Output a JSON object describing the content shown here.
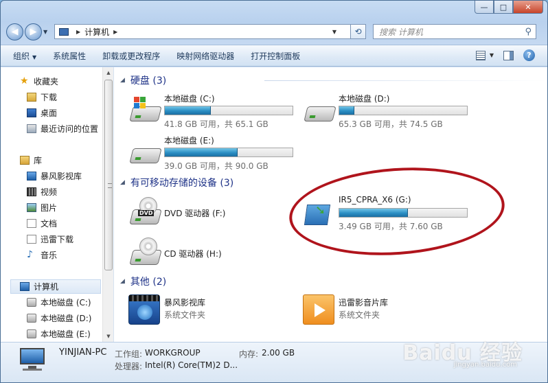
{
  "window": {
    "min": "—",
    "max": "□",
    "close": "✕"
  },
  "address": {
    "location": "计算机",
    "search_placeholder": "搜索 计算机"
  },
  "toolbar": {
    "organize": "组织",
    "system_props": "系统属性",
    "uninstall": "卸载或更改程序",
    "map_drive": "映射网络驱动器",
    "control_panel": "打开控制面板",
    "help": "?"
  },
  "sidebar": {
    "favorites": "收藏夹",
    "fav_items": [
      "下载",
      "桌面",
      "最近访问的位置"
    ],
    "libraries": "库",
    "lib_items": [
      "暴风影视库",
      "视频",
      "图片",
      "文档",
      "迅雷下载",
      "音乐"
    ],
    "computer": "计算机",
    "computer_items": [
      "本地磁盘 (C:)",
      "本地磁盘 (D:)",
      "本地磁盘 (E:)"
    ]
  },
  "groups": {
    "hdd": "硬盘 (3)",
    "removable": "有可移动存储的设备 (3)",
    "other": "其他 (2)"
  },
  "drives": [
    {
      "name": "本地磁盘 (C:)",
      "free": "41.8 GB 可用，共 65.1 GB",
      "used_fraction": 0.36
    },
    {
      "name": "本地磁盘 (D:)",
      "free": "65.3 GB 可用，共 74.5 GB",
      "used_fraction": 0.12
    },
    {
      "name": "本地磁盘 (E:)",
      "free": "39.0 GB 可用，共 90.0 GB",
      "used_fraction": 0.57
    }
  ],
  "removable": [
    {
      "name": "DVD 驱动器 (F:)"
    },
    {
      "name": "IR5_CPRA_X6 (G:)",
      "free": "3.49 GB 可用，共 7.60 GB",
      "used_fraction": 0.54
    },
    {
      "name": "CD 驱动器 (H:)"
    }
  ],
  "other": [
    {
      "name": "暴风影视库",
      "type": "系统文件夹"
    },
    {
      "name": "迅雷影音片库",
      "type": "系统文件夹"
    }
  ],
  "details": {
    "pc_name": "YINJIAN-PC",
    "workgroup_label": "工作组:",
    "workgroup": "WORKGROUP",
    "memory_label": "内存:",
    "memory": "2.00 GB",
    "cpu_label": "处理器:",
    "cpu": "Intel(R) Core(TM)2 D..."
  },
  "watermark": {
    "brand": "Baidu 经验",
    "url": "jingyan.baidu.com"
  },
  "colors": {
    "bar_fill": "#2b8ec3",
    "annotation": "#b0141c",
    "group_header": "#1e3287"
  }
}
